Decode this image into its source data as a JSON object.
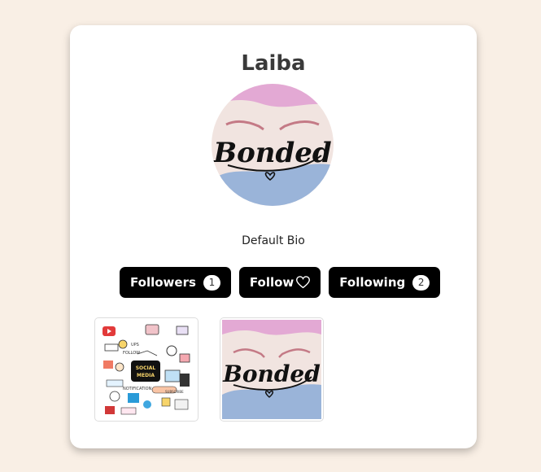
{
  "profile": {
    "name": "Laiba",
    "bio": "Default Bio",
    "avatar_logo_text": "Bonded"
  },
  "buttons": {
    "followers_label": "Followers",
    "followers_count": "1",
    "follow_label": "Follow",
    "following_label": "Following",
    "following_count": "2"
  },
  "posts": [
    {
      "image": "social-media-stickers-collage",
      "logo_text": "SOCIAL MEDIA"
    },
    {
      "image": "bonded-logo",
      "logo_text": "Bonded"
    }
  ],
  "colors": {
    "background": "#f9efe5",
    "button": "#000000",
    "pink": "#e3a9d4",
    "blue": "#9ab4d9",
    "cream": "#f1e4e0"
  }
}
